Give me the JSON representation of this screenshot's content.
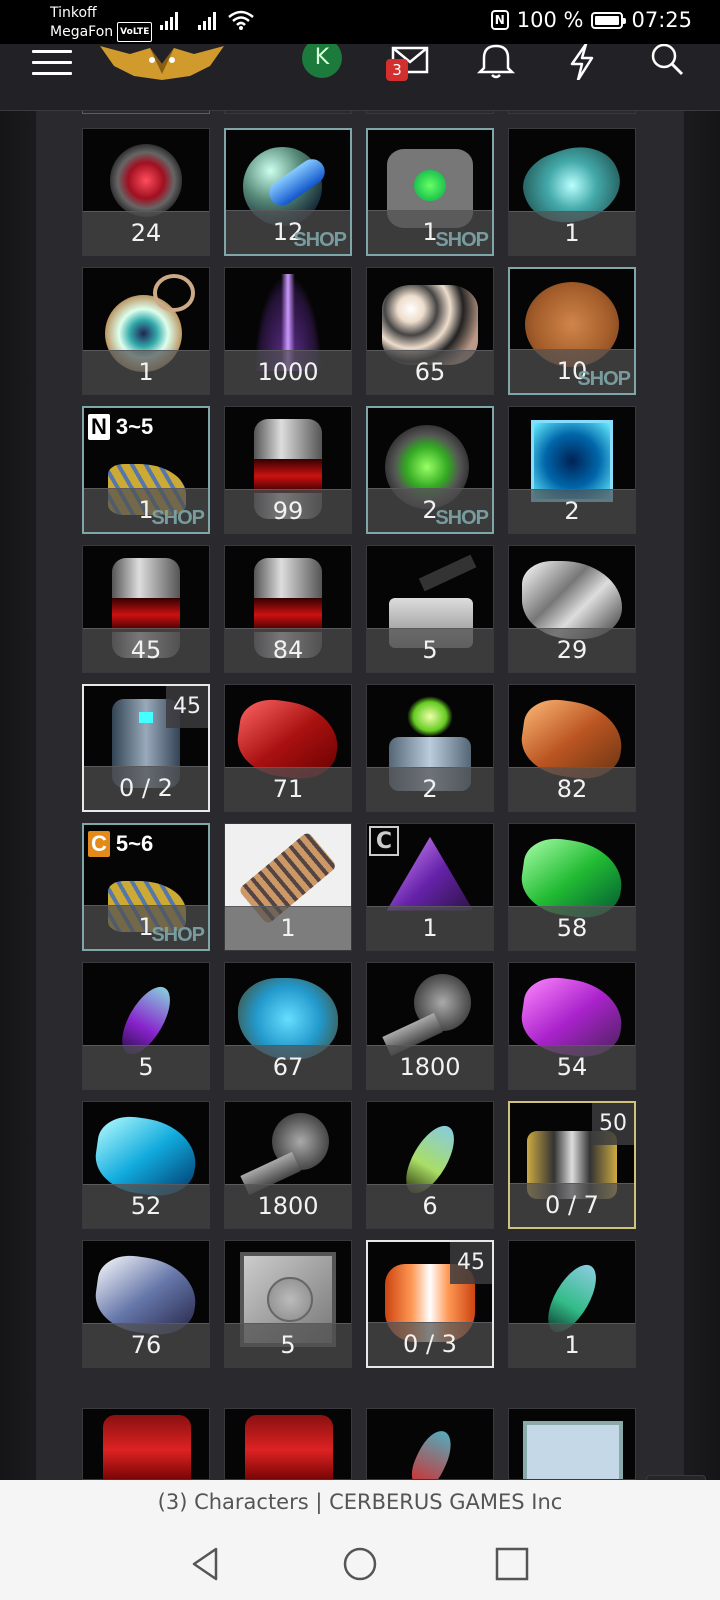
{
  "status_bar": {
    "carrier1": "Tinkoff",
    "carrier2": "MegaFon",
    "volte": "VoLTE",
    "battery": "100 %",
    "time": "07:25"
  },
  "header": {
    "avatar_letter": "K",
    "mail_badge": "3"
  },
  "items": [
    {
      "qty": "24",
      "art": "red-orb"
    },
    {
      "qty": "12",
      "art": "blue-capsule",
      "shop": true
    },
    {
      "qty": "1",
      "art": "green-core-device",
      "shop": true
    },
    {
      "qty": "1",
      "art": "cyan-ore"
    },
    {
      "qty": "1",
      "art": "eye-amulet"
    },
    {
      "qty": "1000",
      "art": "purple-energy"
    },
    {
      "qty": "65",
      "art": "gold-ore"
    },
    {
      "qty": "10",
      "art": "love-cookie",
      "shop": true
    },
    {
      "qty": "1",
      "art": "missile-pack-n",
      "shop": true,
      "tag": "N",
      "tag_text": "3~5"
    },
    {
      "qty": "99",
      "art": "red-canister"
    },
    {
      "qty": "2",
      "art": "green-eye-device",
      "shop": true
    },
    {
      "qty": "2",
      "art": "blue-crystal-box"
    },
    {
      "qty": "45",
      "art": "red-canister"
    },
    {
      "qty": "84",
      "art": "red-canister"
    },
    {
      "qty": "5",
      "art": "cannon-module"
    },
    {
      "qty": "29",
      "art": "silver-ore"
    },
    {
      "qty": "0 / 2",
      "art": "mech-body",
      "level": "45",
      "selected": true
    },
    {
      "qty": "71",
      "art": "red-ore"
    },
    {
      "qty": "2",
      "art": "green-mech"
    },
    {
      "qty": "82",
      "art": "orange-ore"
    },
    {
      "qty": "1",
      "art": "missile-pack-c",
      "shop": true,
      "tag": "C",
      "tag_text": "5~6"
    },
    {
      "qty": "1",
      "art": "ammo-bar",
      "white": true
    },
    {
      "qty": "1",
      "art": "purple-gem",
      "tag2": "C"
    },
    {
      "qty": "58",
      "art": "green-ore"
    },
    {
      "qty": "5",
      "art": "purple-feather"
    },
    {
      "qty": "67",
      "art": "blue-ore"
    },
    {
      "qty": "1800",
      "art": "gun-barrel"
    },
    {
      "qty": "54",
      "art": "purple-ore"
    },
    {
      "qty": "52",
      "art": "cyan-ore-2"
    },
    {
      "qty": "1800",
      "art": "gun-barrel"
    },
    {
      "qty": "6",
      "art": "green-feather"
    },
    {
      "qty": "0 / 7",
      "art": "yellow-mech",
      "level": "50",
      "gold": true
    },
    {
      "qty": "76",
      "art": "silver-blue-ore"
    },
    {
      "qty": "5",
      "art": "steel-plate"
    },
    {
      "qty": "0 / 3",
      "art": "orange-armor",
      "level": "45",
      "selected": true
    },
    {
      "qty": "1",
      "art": "teal-feather"
    }
  ],
  "page_title": "(3) Characters | CERBERUS GAMES Inc",
  "colors": {
    "shop_border": "#7fa6a8",
    "selected_border": "#e8e8e8",
    "gold_border": "#cfc27a",
    "badge": "#d32f2f",
    "avatar": "#1d7a3d"
  }
}
